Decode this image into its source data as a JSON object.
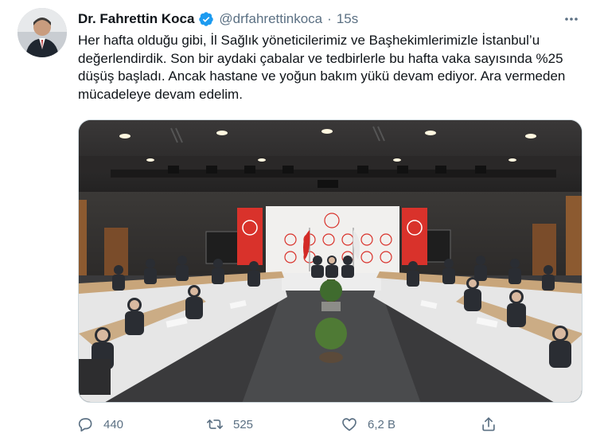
{
  "tweet": {
    "author_name": "Dr. Fahrettin Koca",
    "handle": "@drfahrettinkoca",
    "separator": "·",
    "time": "15s",
    "text": "Her hafta olduğu gibi, İl Sağlık yöneticilerimiz ve Başhekimlerimizle İstanbul’u değerlendirdik. Son bir aydaki çabalar ve tedbirlerle bu hafta vaka sayısında %25 düşüş başladı. Ancak hastane ve yoğun bakım yükü devam ediyor. Ara vermeden mücadeleye devam edelim.",
    "reply_count": "440",
    "retweet_count": "525",
    "like_count": "6,2 B"
  },
  "icons": {
    "verified": "verified-badge-icon",
    "more": "more-icon",
    "reply": "reply-icon",
    "retweet": "retweet-icon",
    "like": "heart-icon",
    "share": "share-icon"
  },
  "colors": {
    "text": "#0f1419",
    "secondary": "#5b7083",
    "verified": "#1d9bf0",
    "banner_red": "#d9322b"
  }
}
